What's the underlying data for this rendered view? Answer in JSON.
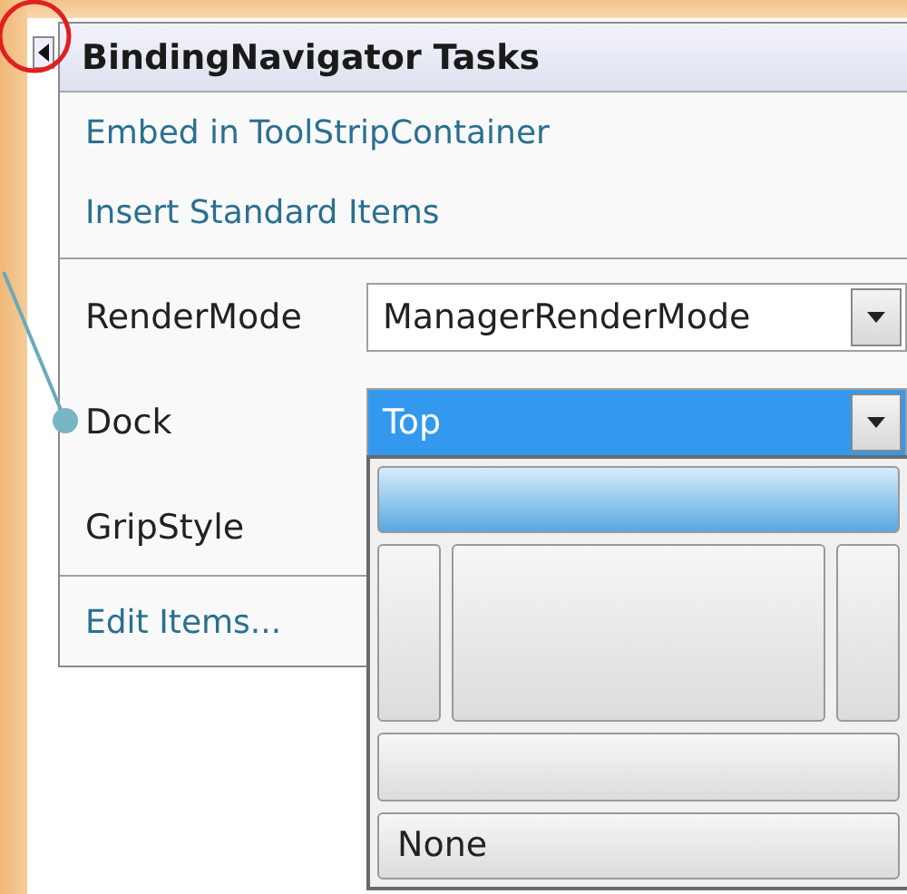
{
  "panel": {
    "title": "BindingNavigator Tasks",
    "links": [
      {
        "label": "Embed in ToolStripContainer"
      },
      {
        "label": "Insert Standard Items"
      }
    ],
    "properties": [
      {
        "label": "RenderMode",
        "value": "ManagerRenderMode"
      },
      {
        "label": "Dock",
        "value": "Top",
        "open": true
      },
      {
        "label": "GripStyle"
      }
    ],
    "footer_link": {
      "label": "Edit Items..."
    }
  },
  "dock_picker": {
    "items": [
      {
        "kind": "top",
        "selected": true
      },
      {
        "kind": "left",
        "selected": false
      },
      {
        "kind": "fill",
        "selected": false
      },
      {
        "kind": "right",
        "selected": false
      },
      {
        "kind": "bottom",
        "selected": false
      },
      {
        "kind": "none",
        "label": "None",
        "selected": false
      }
    ]
  }
}
